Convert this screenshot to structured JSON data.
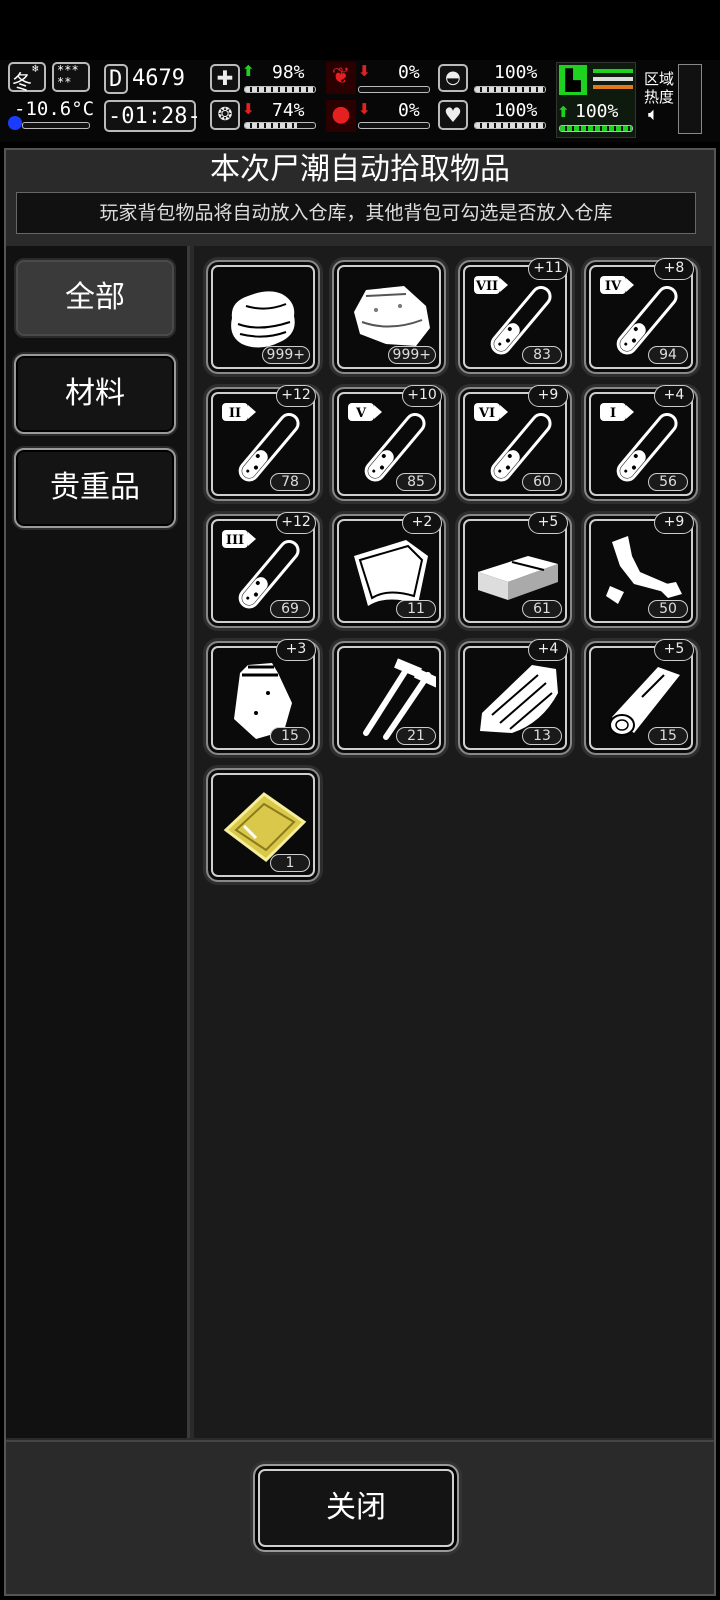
{
  "status": {
    "season": "冬",
    "weather": "***\n**",
    "temperature": "-10.6°C",
    "day_number": "4679",
    "day_prefix": "D",
    "time": "-01:28-",
    "health_pct": "98%",
    "brain_pct": "74%",
    "stomach_pct": "0%",
    "blood_pct": "0%",
    "pill_pct": "100%",
    "heart_pct": "100%",
    "stamina_pct": "100%",
    "zone_label_1": "区域",
    "zone_label_2": "热度",
    "colors": {
      "good": "#1fd21f",
      "bad": "#e52020",
      "temp_indicator": "#1a3cff"
    }
  },
  "dialog": {
    "title": "本次尸潮自动拾取物品",
    "subtitle": "玩家背包物品将自动放入仓库，其他背包可勾选是否放入仓库",
    "tabs": [
      {
        "label": "全部",
        "active": true
      },
      {
        "label": "材料",
        "active": false
      },
      {
        "label": "贵重品",
        "active": false
      }
    ],
    "close_label": "关闭"
  },
  "items": [
    {
      "icon": "cloth-icon",
      "count": "999+",
      "bonus": ""
    },
    {
      "icon": "meat-icon",
      "count": "999+",
      "bonus": ""
    },
    {
      "icon": "test-tube-icon",
      "tier": "VII",
      "count": "83",
      "bonus": "+11"
    },
    {
      "icon": "test-tube-icon",
      "tier": "IV",
      "count": "94",
      "bonus": "+8"
    },
    {
      "icon": "test-tube-icon",
      "tier": "II",
      "count": "78",
      "bonus": "+12"
    },
    {
      "icon": "test-tube-icon",
      "tier": "V",
      "count": "85",
      "bonus": "+10"
    },
    {
      "icon": "test-tube-icon",
      "tier": "VI",
      "count": "60",
      "bonus": "+9"
    },
    {
      "icon": "test-tube-icon",
      "tier": "I",
      "count": "56",
      "bonus": "+4"
    },
    {
      "icon": "test-tube-icon",
      "tier": "III",
      "count": "69",
      "bonus": "+12"
    },
    {
      "icon": "leather-icon",
      "count": "11",
      "bonus": "+2"
    },
    {
      "icon": "brick-icon",
      "count": "61",
      "bonus": "+5"
    },
    {
      "icon": "scrap-icon",
      "count": "50",
      "bonus": "+9"
    },
    {
      "icon": "bag-icon",
      "count": "15",
      "bonus": "+3"
    },
    {
      "icon": "nails-icon",
      "count": "21",
      "bonus": ""
    },
    {
      "icon": "wood-planks-icon",
      "count": "13",
      "bonus": "+4"
    },
    {
      "icon": "log-icon",
      "count": "15",
      "bonus": "+5"
    },
    {
      "icon": "gold-card-icon",
      "count": "1",
      "bonus": ""
    }
  ]
}
